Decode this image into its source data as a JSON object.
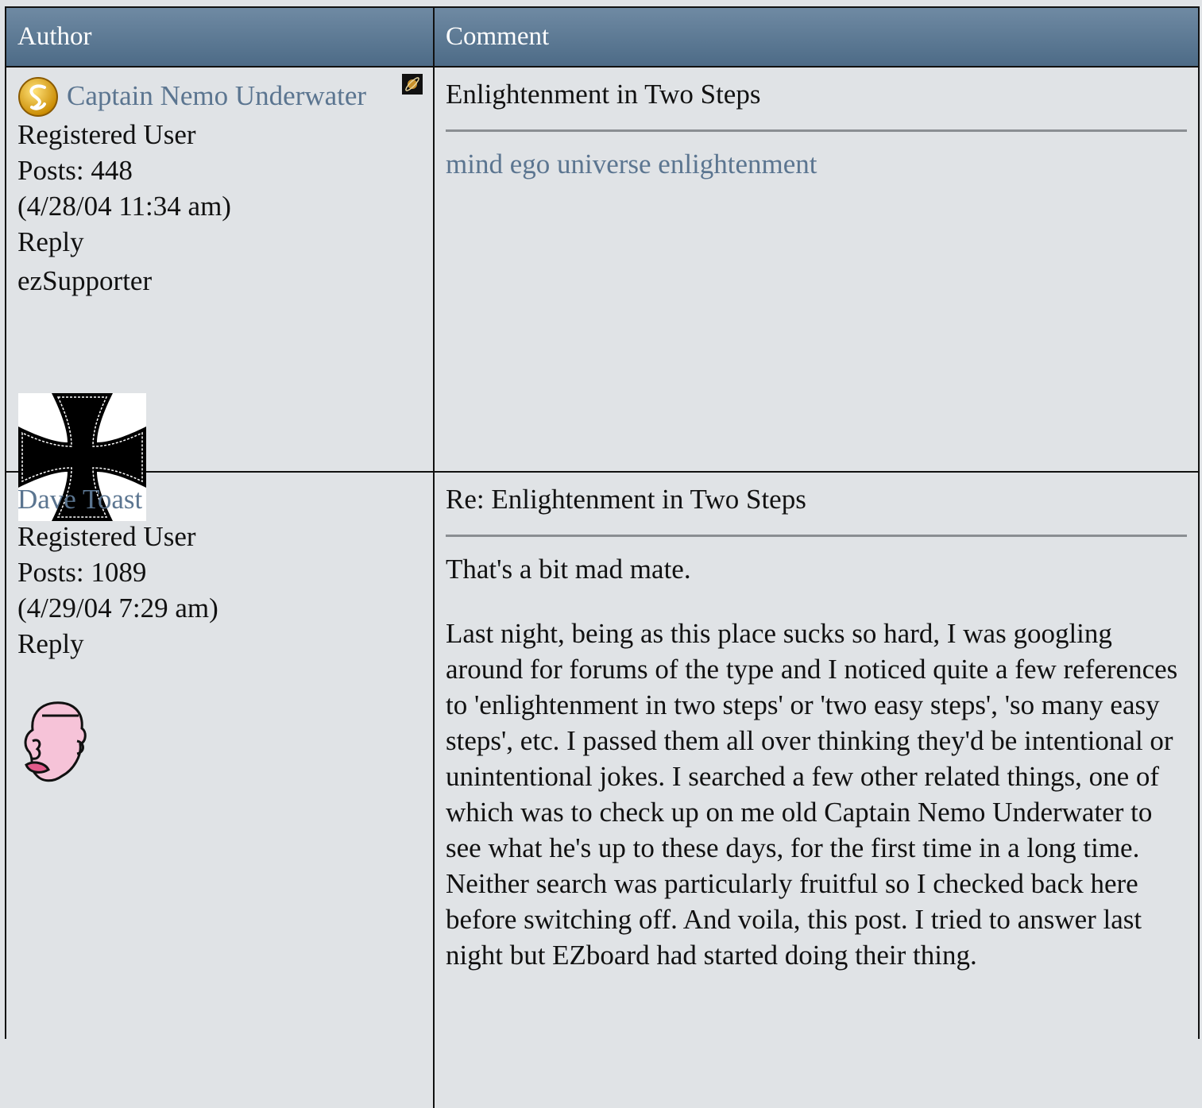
{
  "header": {
    "author": "Author",
    "comment": "Comment"
  },
  "posts": [
    {
      "author": "Captain Nemo Underwater",
      "role": "Registered User",
      "posts": "Posts: 448",
      "date": "(4/28/04 11:34 am)",
      "reply": "Reply",
      "badge": "ezSupporter",
      "subject": "Enlightenment in Two Steps",
      "body_link": "mind ego universe enlightenment",
      "icons": [
        "level-icon",
        "planet-icon",
        "iron-cross-avatar"
      ]
    },
    {
      "author": "Dave Toast",
      "role": "Registered User",
      "posts": "Posts: 1089",
      "date": "(4/29/04 7:29 am)",
      "reply": "Reply",
      "subject": "Re: Enlightenment in Two Steps",
      "paragraphs": [
        "That's a bit mad mate.",
        "Last night, being as this place sucks so hard, I was googling around for forums of the type and I noticed quite a few references to 'enlightenment in two steps' or 'two easy steps', 'so many easy steps', etc. I passed them all over thinking they'd be intentional or unintentional jokes. I searched a few other related things, one of which was to check up on me old Captain Nemo Underwater to see what he's up to these days, for the first time in a long time. Neither search was particularly fruitful so I checked back here before switching off. And voila, this post. I tried to answer last night but EZboard had started doing their thing."
      ],
      "icons": [
        "cartoon-face-avatar"
      ]
    }
  ],
  "colors": {
    "header_top": "#6f8aa3",
    "header_bottom": "#4d6b87",
    "link": "#5b7590",
    "background": "#e0e3e6"
  }
}
